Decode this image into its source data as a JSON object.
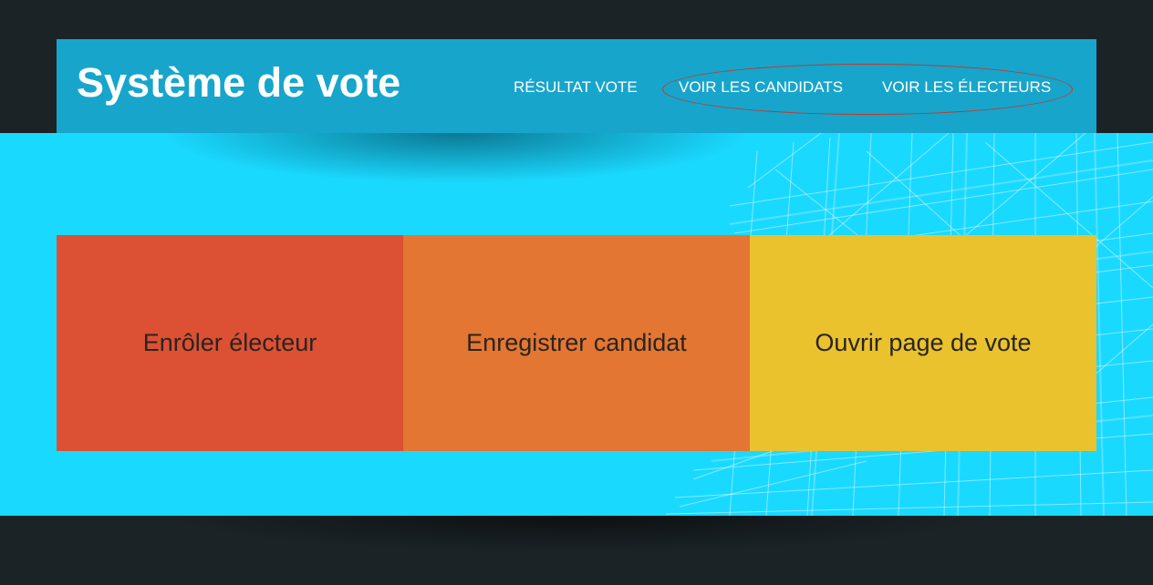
{
  "header": {
    "title": "Système de vote",
    "nav": [
      {
        "label": "RÉSULTAT VOTE"
      },
      {
        "label": "VOIR LES CANDIDATS"
      },
      {
        "label": "VOIR LES ÉLECTEURS"
      }
    ]
  },
  "tiles": [
    {
      "label": "Enrôler électeur",
      "color": "#dc5033"
    },
    {
      "label": "Enregistrer candidat",
      "color": "#e37632"
    },
    {
      "label": "Ouvrir page de vote",
      "color": "#e9c22d"
    }
  ],
  "colors": {
    "background": "#1b2327",
    "header": "#17a5cc",
    "hero": "#1ad9ff",
    "annotation": "#c0392b"
  }
}
